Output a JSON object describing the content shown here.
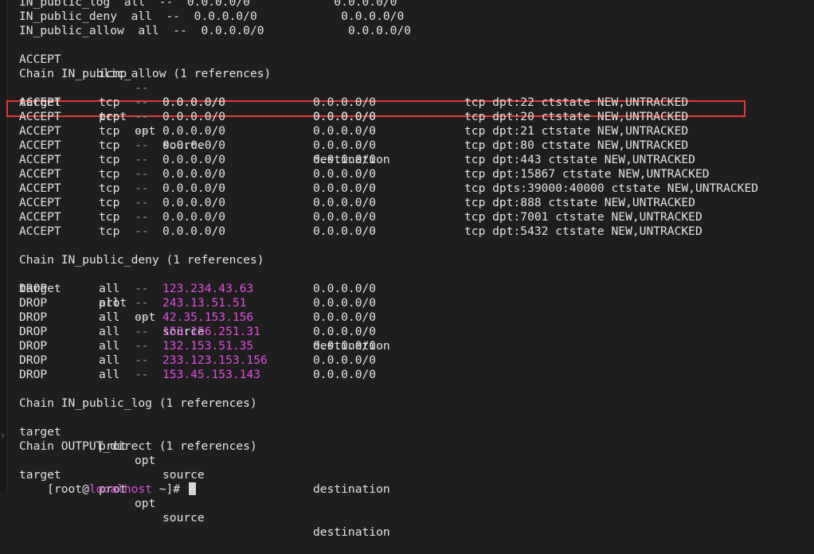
{
  "top_rows": [
    {
      "text": "IN_public_log  all  --  0.0.0.0/0            0.0.0.0/0"
    },
    {
      "text": "IN_public_deny  all  --  0.0.0.0/0            0.0.0.0/0"
    },
    {
      "text": "IN_public_allow  all  --  0.0.0.0/0            0.0.0.0/0"
    }
  ],
  "icmp_row": {
    "target": "ACCEPT",
    "prot": "icmp",
    "opt": "--",
    "source": "0.0.0.0/0",
    "destination": "0.0.0.0/0"
  },
  "chain_allow": {
    "title": "Chain IN_public_allow (1 references)",
    "headers": {
      "target": "target",
      "prot": "prot",
      "opt": "opt",
      "source": "source",
      "destination": "destination"
    },
    "rows": [
      {
        "target": "ACCEPT",
        "prot": "tcp",
        "opt": "--",
        "source": "0.0.0.0/0",
        "destination": "0.0.0.0/0",
        "ext": "tcp dpt:22 ctstate NEW,UNTRACKED"
      },
      {
        "target": "ACCEPT",
        "prot": "tcp",
        "opt": "--",
        "source": "0.0.0.0/0",
        "destination": "0.0.0.0/0",
        "ext": "tcp dpt:20 ctstate NEW,UNTRACKED"
      },
      {
        "target": "ACCEPT",
        "prot": "tcp",
        "opt": "--",
        "source": "0.0.0.0/0",
        "destination": "0.0.0.0/0",
        "ext": "tcp dpt:21 ctstate NEW,UNTRACKED"
      },
      {
        "target": "ACCEPT",
        "prot": "tcp",
        "opt": "--",
        "source": "0.0.0.0/0",
        "destination": "0.0.0.0/0",
        "ext": "tcp dpt:80 ctstate NEW,UNTRACKED"
      },
      {
        "target": "ACCEPT",
        "prot": "tcp",
        "opt": "--",
        "source": "0.0.0.0/0",
        "destination": "0.0.0.0/0",
        "ext": "tcp dpt:443 ctstate NEW,UNTRACKED"
      },
      {
        "target": "ACCEPT",
        "prot": "tcp",
        "opt": "--",
        "source": "0.0.0.0/0",
        "destination": "0.0.0.0/0",
        "ext": "tcp dpt:15867 ctstate NEW,UNTRACKED"
      },
      {
        "target": "ACCEPT",
        "prot": "tcp",
        "opt": "--",
        "source": "0.0.0.0/0",
        "destination": "0.0.0.0/0",
        "ext": "tcp dpts:39000:40000 ctstate NEW,UNTRACKED"
      },
      {
        "target": "ACCEPT",
        "prot": "tcp",
        "opt": "--",
        "source": "0.0.0.0/0",
        "destination": "0.0.0.0/0",
        "ext": "tcp dpt:888 ctstate NEW,UNTRACKED"
      },
      {
        "target": "ACCEPT",
        "prot": "tcp",
        "opt": "--",
        "source": "0.0.0.0/0",
        "destination": "0.0.0.0/0",
        "ext": "tcp dpt:7001 ctstate NEW,UNTRACKED"
      },
      {
        "target": "ACCEPT",
        "prot": "tcp",
        "opt": "--",
        "source": "0.0.0.0/0",
        "destination": "0.0.0.0/0",
        "ext": "tcp dpt:5432 ctstate NEW,UNTRACKED"
      }
    ]
  },
  "chain_deny": {
    "title": "Chain IN_public_deny (1 references)",
    "headers": {
      "target": "target",
      "prot": "prot",
      "opt": "opt",
      "source": "source",
      "destination": "destination"
    },
    "rows": [
      {
        "target": "DROP",
        "prot": "all",
        "opt": "--",
        "source": "123.234.43.63",
        "destination": "0.0.0.0/0"
      },
      {
        "target": "DROP",
        "prot": "all",
        "opt": "--",
        "source": "243.13.51.51",
        "destination": "0.0.0.0/0"
      },
      {
        "target": "DROP",
        "prot": "all",
        "opt": "--",
        "source": "42.35.153.156",
        "destination": "0.0.0.0/0"
      },
      {
        "target": "DROP",
        "prot": "all",
        "opt": "--",
        "source": "153.156.251.31",
        "destination": "0.0.0.0/0"
      },
      {
        "target": "DROP",
        "prot": "all",
        "opt": "--",
        "source": "132.153.51.35",
        "destination": "0.0.0.0/0"
      },
      {
        "target": "DROP",
        "prot": "all",
        "opt": "--",
        "source": "233.123.153.156",
        "destination": "0.0.0.0/0"
      },
      {
        "target": "DROP",
        "prot": "all",
        "opt": "--",
        "source": "153.45.153.143",
        "destination": "0.0.0.0/0"
      }
    ]
  },
  "chain_log": {
    "title": "Chain IN_public_log (1 references)",
    "headers": {
      "target": "target",
      "prot": "prot",
      "opt": "opt",
      "source": "source",
      "destination": "destination"
    }
  },
  "chain_output": {
    "title": "Chain OUTPUT_direct (1 references)",
    "headers": {
      "target": "target",
      "prot": "prot",
      "opt": "opt",
      "source": "source",
      "destination": "destination"
    }
  },
  "prompt": {
    "open": "[root@",
    "host": "localhost",
    "close": " ~]# "
  },
  "gutter_icon": "chevron-right-icon",
  "colors": {
    "ip": "#e24de0",
    "opt": "#6aa3c8",
    "highlight": "#e53935",
    "background": "#1e1e1e"
  }
}
